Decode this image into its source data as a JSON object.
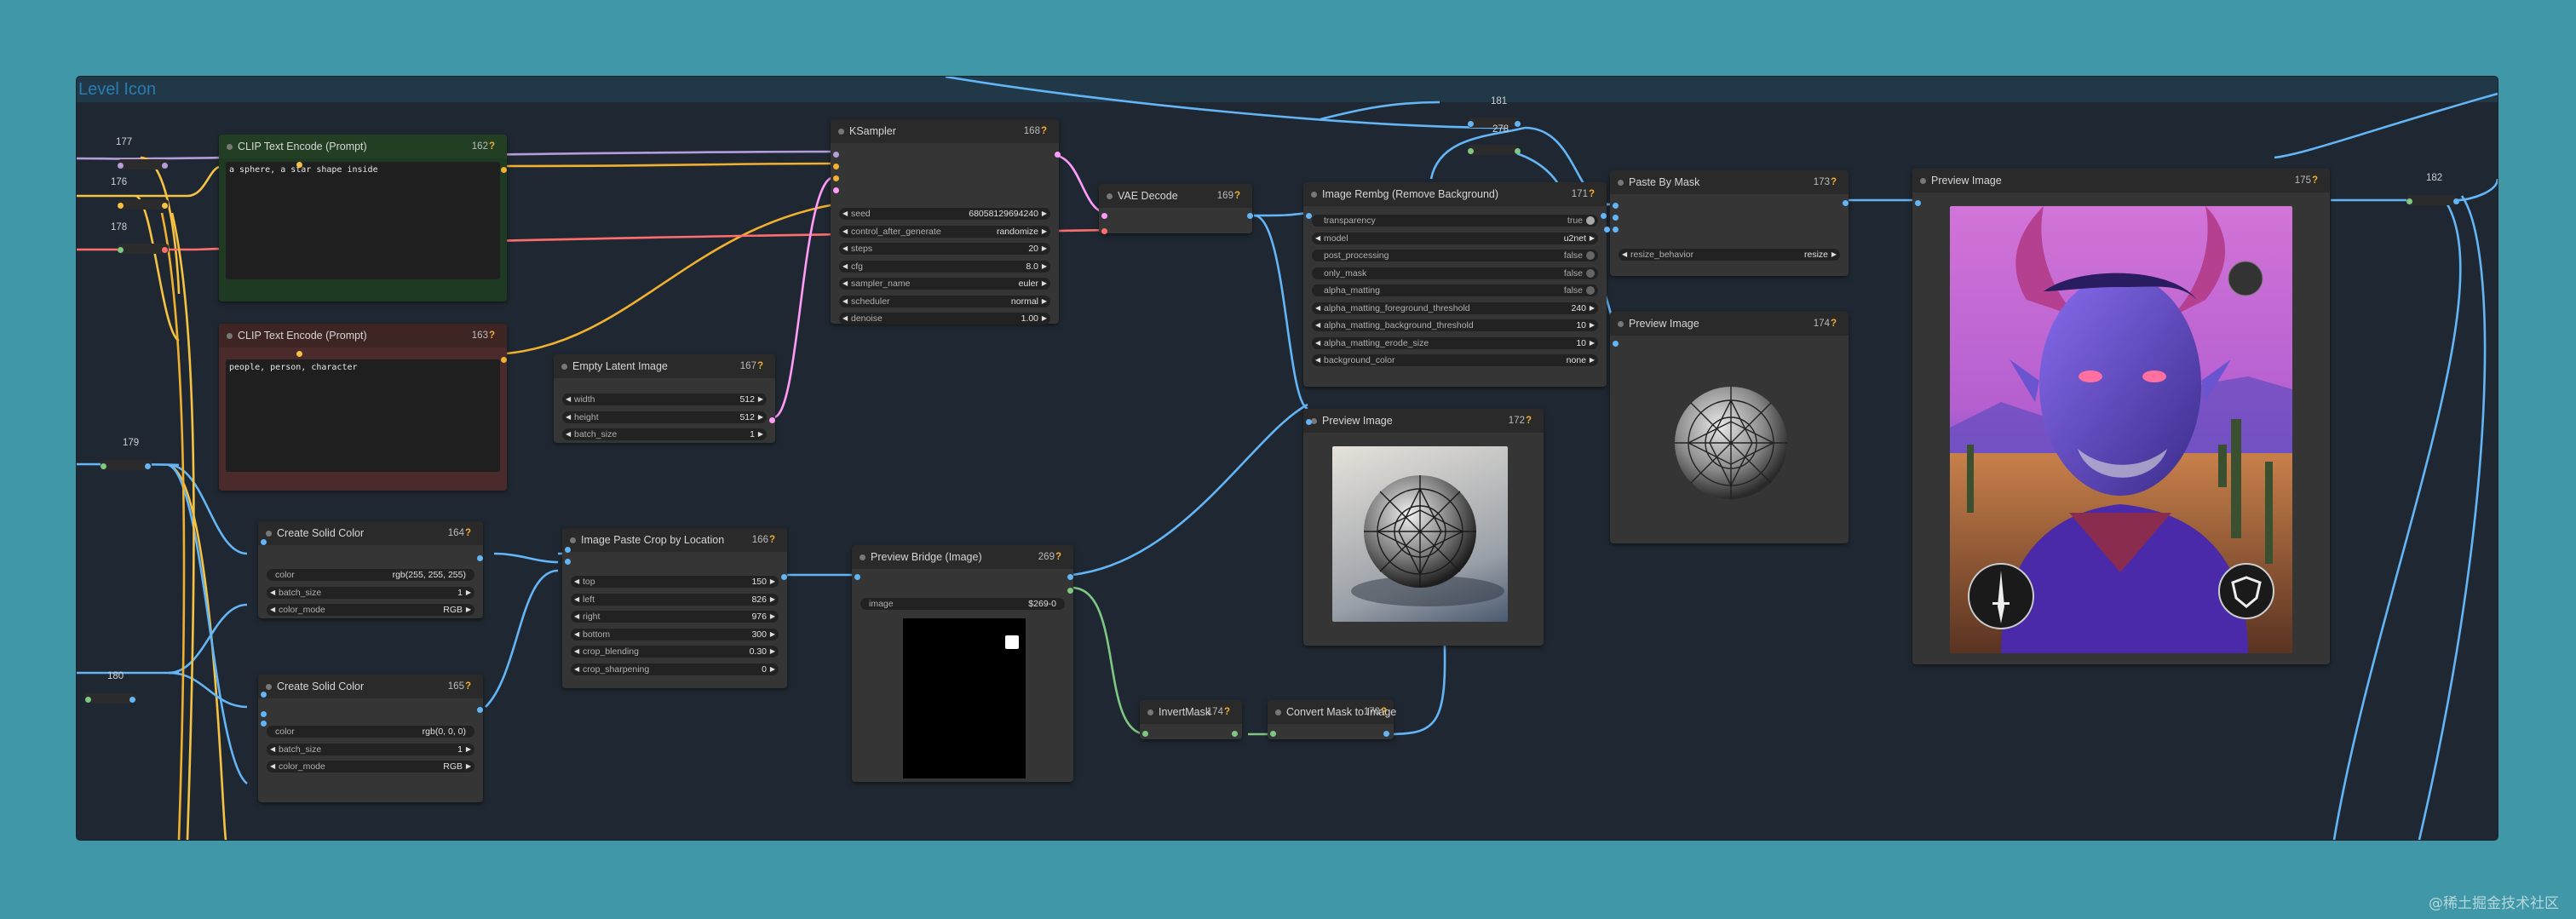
{
  "group": {
    "title": "Level Icon"
  },
  "reroutes": [
    {
      "id": "177"
    },
    {
      "id": "176"
    },
    {
      "id": "178"
    },
    {
      "id": "179"
    },
    {
      "id": "180"
    },
    {
      "id": "181"
    },
    {
      "id": "278"
    },
    {
      "id": "182"
    }
  ],
  "nodes": {
    "clip_pos": {
      "title": "CLIP Text Encode (Prompt)",
      "id": "162",
      "text": "a sphere, a star shape inside"
    },
    "clip_neg": {
      "title": "CLIP Text Encode (Prompt)",
      "id": "163",
      "text": "people, person, character"
    },
    "ksampler": {
      "title": "KSampler",
      "id": "168",
      "widgets": [
        {
          "label": "seed",
          "value": "68058129694240"
        },
        {
          "label": "control_after_generate",
          "value": "randomize"
        },
        {
          "label": "steps",
          "value": "20"
        },
        {
          "label": "cfg",
          "value": "8.0"
        },
        {
          "label": "sampler_name",
          "value": "euler"
        },
        {
          "label": "scheduler",
          "value": "normal"
        },
        {
          "label": "denoise",
          "value": "1.00"
        }
      ]
    },
    "vae_decode": {
      "title": "VAE Decode",
      "id": "169"
    },
    "rembg": {
      "title": "Image Rembg (Remove Background)",
      "id": "171",
      "widgets": [
        {
          "label": "transparency",
          "value": "true",
          "kind": "toggle",
          "on": true
        },
        {
          "label": "model",
          "value": "u2net"
        },
        {
          "label": "post_processing",
          "value": "false",
          "kind": "toggle"
        },
        {
          "label": "only_mask",
          "value": "false",
          "kind": "toggle"
        },
        {
          "label": "alpha_matting",
          "value": "false",
          "kind": "toggle"
        },
        {
          "label": "alpha_matting_foreground_threshold",
          "value": "240"
        },
        {
          "label": "alpha_matting_background_threshold",
          "value": "10"
        },
        {
          "label": "alpha_matting_erode_size",
          "value": "10"
        },
        {
          "label": "background_color",
          "value": "none"
        }
      ]
    },
    "paste_mask": {
      "title": "Paste By Mask",
      "id": "173",
      "widgets": [
        {
          "label": "resize_behavior",
          "value": "resize"
        }
      ]
    },
    "preview_174": {
      "title": "Preview Image",
      "id": "174"
    },
    "preview_175": {
      "title": "Preview Image",
      "id": "175"
    },
    "preview_172": {
      "title": "Preview Image",
      "id": "172"
    },
    "empty_latent": {
      "title": "Empty Latent Image",
      "id": "167",
      "widgets": [
        {
          "label": "width",
          "value": "512"
        },
        {
          "label": "height",
          "value": "512"
        },
        {
          "label": "batch_size",
          "value": "1"
        }
      ]
    },
    "solid_164": {
      "title": "Create Solid Color",
      "id": "164",
      "widgets": [
        {
          "label": "color",
          "value": "rgb(255, 255, 255)",
          "kind": "text"
        },
        {
          "label": "batch_size",
          "value": "1"
        },
        {
          "label": "color_mode",
          "value": "RGB"
        }
      ]
    },
    "solid_165": {
      "title": "Create Solid Color",
      "id": "165",
      "widgets": [
        {
          "label": "color",
          "value": "rgb(0, 0, 0)",
          "kind": "text"
        },
        {
          "label": "batch_size",
          "value": "1"
        },
        {
          "label": "color_mode",
          "value": "RGB"
        }
      ]
    },
    "paste_crop": {
      "title": "Image Paste Crop by Location",
      "id": "166",
      "widgets": [
        {
          "label": "top",
          "value": "150"
        },
        {
          "label": "left",
          "value": "826"
        },
        {
          "label": "right",
          "value": "976"
        },
        {
          "label": "bottom",
          "value": "300"
        },
        {
          "label": "crop_blending",
          "value": "0.30"
        },
        {
          "label": "crop_sharpening",
          "value": "0"
        }
      ]
    },
    "preview_bridge": {
      "title": "Preview Bridge (Image)",
      "id": "269",
      "widgets": [
        {
          "label": "image",
          "value": "$269-0",
          "kind": "text"
        }
      ]
    },
    "invert_mask": {
      "title": "InvertMask",
      "id": "174"
    },
    "mask_to_image": {
      "title": "Convert Mask to Image",
      "id": "170"
    }
  },
  "colors": {
    "canvas_bg": "#1f2832",
    "page_bg": "#3f97a7",
    "wire_clip": "#f5c242",
    "wire_cond": "#f0b030",
    "wire_model": "#b39ddb",
    "wire_vae": "#ff6e6e",
    "wire_latent": "#ff9cf9",
    "wire_image": "#64b5f6",
    "wire_mask": "#81c784"
  },
  "watermark": "@稀土掘金技术社区"
}
